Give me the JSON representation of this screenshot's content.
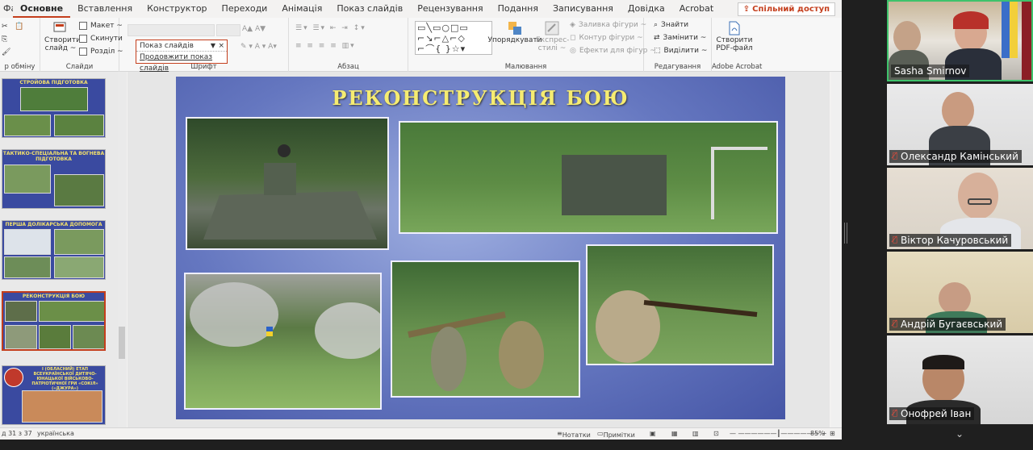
{
  "ribbon_tabs": [
    "Файл",
    "Основне",
    "Вставлення",
    "Конструктор",
    "Переходи",
    "Анімація",
    "Показ слайдів",
    "Рецензування",
    "Подання",
    "Записування",
    "Довідка",
    "Acrobat"
  ],
  "active_tab": "Основне",
  "share_label": "Спільний доступ",
  "ribbon": {
    "clipboard_label": "р обміну",
    "create_slide_label": "Створити слайд ~",
    "layout_label": "Макет ~",
    "reset_label": "Скинути",
    "section_label": "Розділ ~",
    "slides_group_label": "Слайди",
    "font_group_label": "Шрифт",
    "paragraph_group_label": "Абзац",
    "arrange_label": "Упорядкувати",
    "quick_styles_label": "Експрес-стилі ~",
    "shape_fill_label": "Заливка фігури ~",
    "shape_outline_label": "Контур фігури ~",
    "shape_effects_label": "Ефекти для фігур ~",
    "drawing_group_label": "Малювання",
    "find_label": "Знайти",
    "replace_label": "Замінити ~",
    "select_label": "Виділити ~",
    "editing_group_label": "Редагування",
    "create_pdf_label": "Створити PDF-файл",
    "acrobat_group_label": "Adobe Acrobat"
  },
  "dropdown": {
    "item1": "Показ слайдів",
    "item2": "Продовжити показ слайдів"
  },
  "thumbnails": [
    {
      "title": "СТРОЙОВА ПІДГОТОВКА"
    },
    {
      "title": "ТАКТИКО-СПЕЦІАЛЬНА ТА ВОГНЕВА ПІДГОТОВКА"
    },
    {
      "title": "ПЕРША ДОЛІКАРСЬКА ДОПОМОГА"
    },
    {
      "title": "РЕКОНСТРУКЦІЯ БОЮ"
    },
    {
      "title": "І (ОБЛАСНИЙ) ЕТАП ВСЕУКРАЇНСЬКОЇ ДИТЯЧО-ЮНАЦЬКОЇ ВІЙСЬКОВО-ПАТРІОТИЧНОЇ ГРИ «СОКІЛ» («ДЖУРА»)"
    }
  ],
  "selected_thumbnail_index": 3,
  "slide": {
    "title": "РЕКОНСТРУКЦІЯ БОЮ"
  },
  "status": {
    "slide_counter": "д 31 з 37",
    "language": "українська",
    "notes_label": "Нотатки",
    "comments_label": "Примітки",
    "zoom": "85%"
  },
  "participants": [
    {
      "name": "Sasha Smirnov",
      "muted": false,
      "active": true
    },
    {
      "name": "Олександр Камінський",
      "muted": true,
      "active": false
    },
    {
      "name": "Віктор Качуровський",
      "muted": true,
      "active": false
    },
    {
      "name": "Андрій Бугаєвський",
      "muted": true,
      "active": false
    },
    {
      "name": "Онофрей Іван",
      "muted": true,
      "active": false
    }
  ],
  "colors": {
    "accent": "#c43e1c",
    "slide_title": "#f6ec71",
    "active_speaker": "#3ec26b",
    "muted_mic": "#e74c3c"
  }
}
